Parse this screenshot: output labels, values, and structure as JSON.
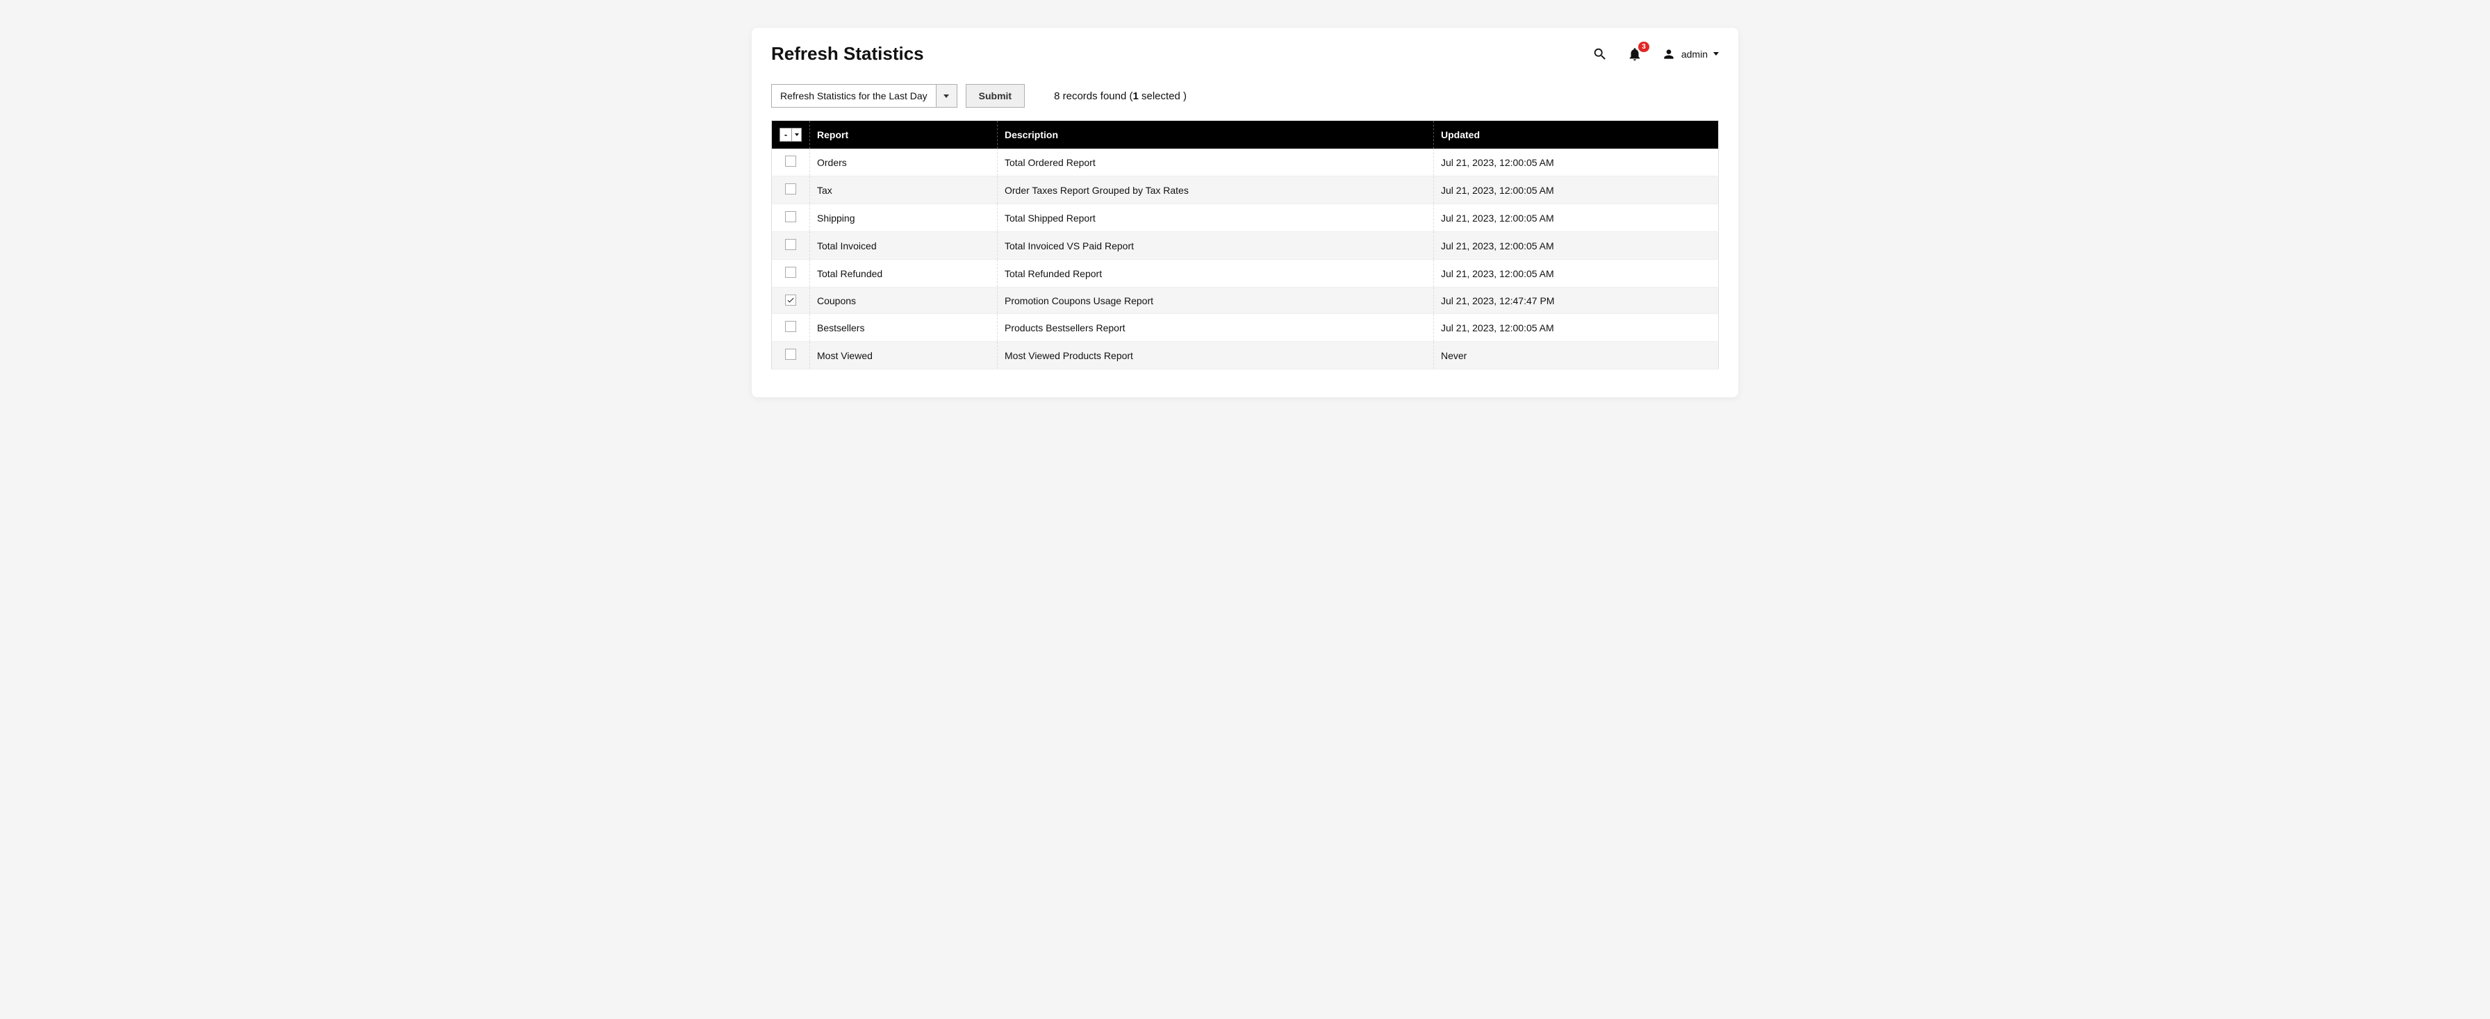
{
  "header": {
    "title": "Refresh Statistics",
    "notification_count": "3",
    "username": "admin"
  },
  "toolbar": {
    "action_select_label": "Refresh Statistics for the Last Day",
    "submit_label": "Submit",
    "records_count": "8",
    "records_text_a": " records found (",
    "selected_count": "1",
    "records_text_b": " selected )"
  },
  "table": {
    "columns": {
      "report": "Report",
      "description": "Description",
      "updated": "Updated"
    },
    "rows": [
      {
        "checked": false,
        "report": "Orders",
        "description": "Total Ordered Report",
        "updated": "Jul 21, 2023, 12:00:05 AM"
      },
      {
        "checked": false,
        "report": "Tax",
        "description": "Order Taxes Report Grouped by Tax Rates",
        "updated": "Jul 21, 2023, 12:00:05 AM"
      },
      {
        "checked": false,
        "report": "Shipping",
        "description": "Total Shipped Report",
        "updated": "Jul 21, 2023, 12:00:05 AM"
      },
      {
        "checked": false,
        "report": "Total Invoiced",
        "description": "Total Invoiced VS Paid Report",
        "updated": "Jul 21, 2023, 12:00:05 AM"
      },
      {
        "checked": false,
        "report": "Total Refunded",
        "description": "Total Refunded Report",
        "updated": "Jul 21, 2023, 12:00:05 AM"
      },
      {
        "checked": true,
        "report": "Coupons",
        "description": "Promotion Coupons Usage Report",
        "updated": "Jul 21, 2023, 12:47:47 PM"
      },
      {
        "checked": false,
        "report": "Bestsellers",
        "description": "Products Bestsellers Report",
        "updated": "Jul 21, 2023, 12:00:05 AM"
      },
      {
        "checked": false,
        "report": "Most Viewed",
        "description": "Most Viewed Products Report",
        "updated": "Never"
      }
    ]
  }
}
